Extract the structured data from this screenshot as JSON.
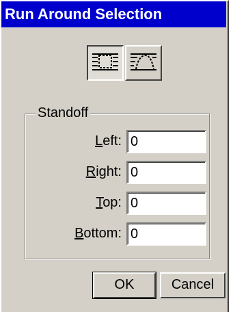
{
  "window": {
    "title": "Run Around Selection"
  },
  "mode_buttons": [
    {
      "icon": "runaround-box-icon",
      "pressed": true
    },
    {
      "icon": "runaround-shape-icon",
      "pressed": false
    }
  ],
  "standoff": {
    "label": "Standoff",
    "fields": [
      {
        "accel": "L",
        "rest": "eft:",
        "value": "0"
      },
      {
        "accel": "R",
        "rest": "ight:",
        "value": "0"
      },
      {
        "accel": "T",
        "rest": "op:",
        "value": "0"
      },
      {
        "accel": "B",
        "rest": "ottom:",
        "value": "0"
      }
    ]
  },
  "buttons": {
    "ok": "OK",
    "cancel": "Cancel"
  }
}
